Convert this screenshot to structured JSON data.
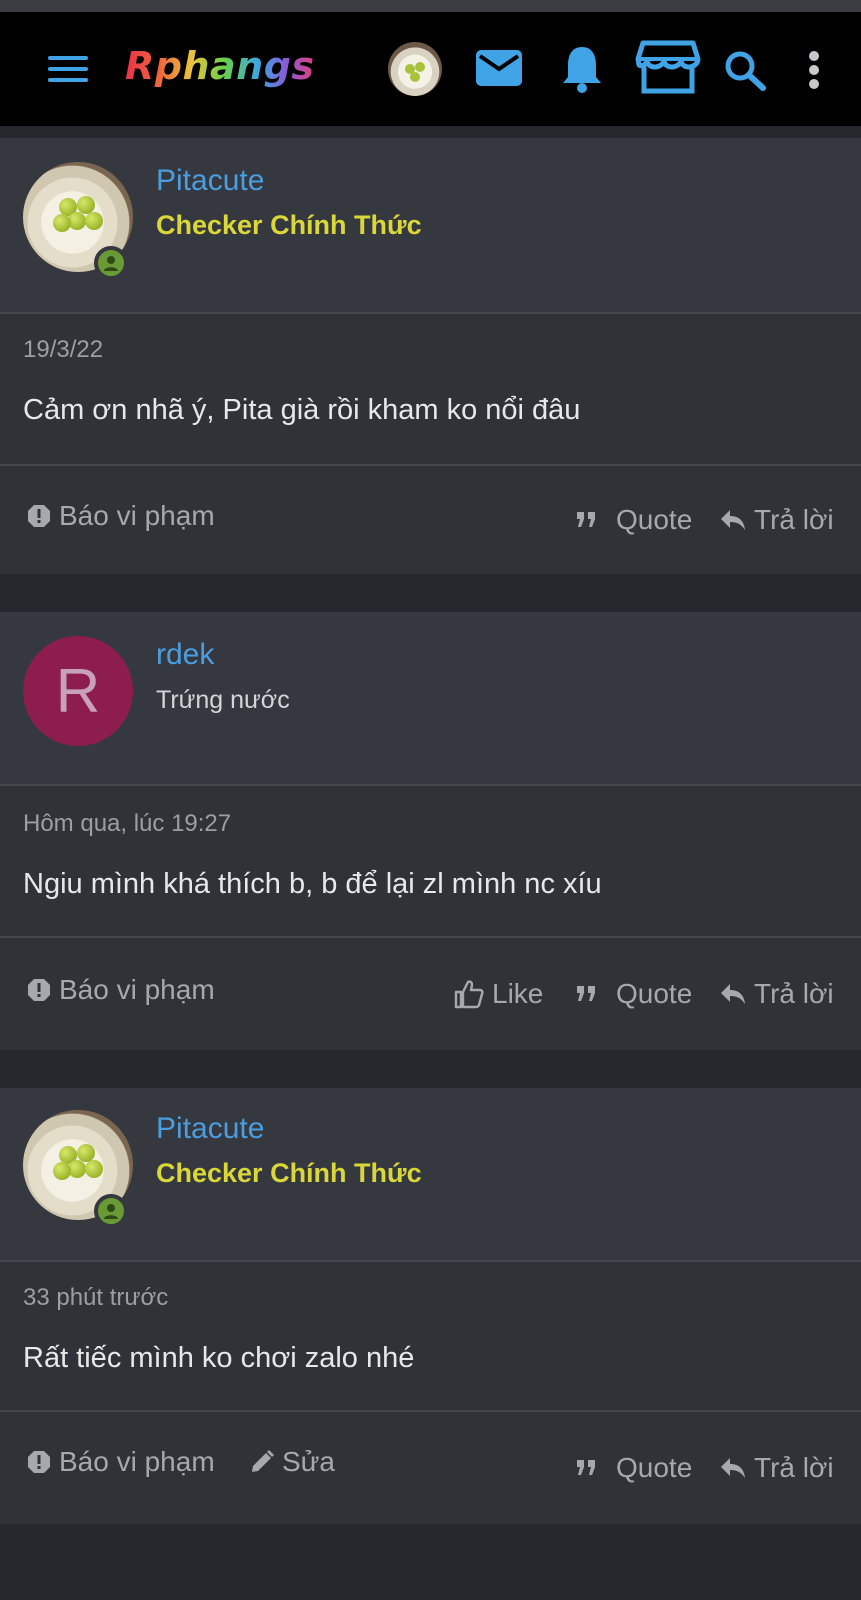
{
  "header": {
    "logo": "Rphangs",
    "icons": [
      "menu-icon",
      "avatar",
      "mail-icon",
      "bell-icon",
      "store-icon",
      "search-icon",
      "more-vertical-icon"
    ]
  },
  "posts": [
    {
      "username": "Pitacute",
      "user_title": "Checker Chính Thức",
      "date": "19/3/22",
      "message": "Cảm ơn nhã ý, Pita già rồi kham ko nổi đâu",
      "actions": {
        "report": "Báo vi phạm",
        "quote": "Quote",
        "reply": "Trả lời"
      }
    },
    {
      "username": "rdek",
      "avatar_letter": "R",
      "user_title": "Trứng nước",
      "date": "Hôm qua, lúc 19:27",
      "message": "Ngiu mình khá thích b, b để lại zl mình nc xíu",
      "actions": {
        "report": "Báo vi phạm",
        "like": "Like",
        "quote": "Quote",
        "reply": "Trả lời"
      }
    },
    {
      "username": "Pitacute",
      "user_title": "Checker Chính Thức",
      "date": "33 phút trước",
      "message": "Rất tiếc mình ko chơi zalo nhé",
      "actions": {
        "report": "Báo vi phạm",
        "edit": "Sửa",
        "quote": "Quote",
        "reply": "Trả lời"
      }
    }
  ],
  "colors": {
    "accent": "#4a9ee0",
    "title_gold": "#dad738",
    "online": "#6a9a35",
    "background": "#26282d",
    "card": "#303238"
  }
}
